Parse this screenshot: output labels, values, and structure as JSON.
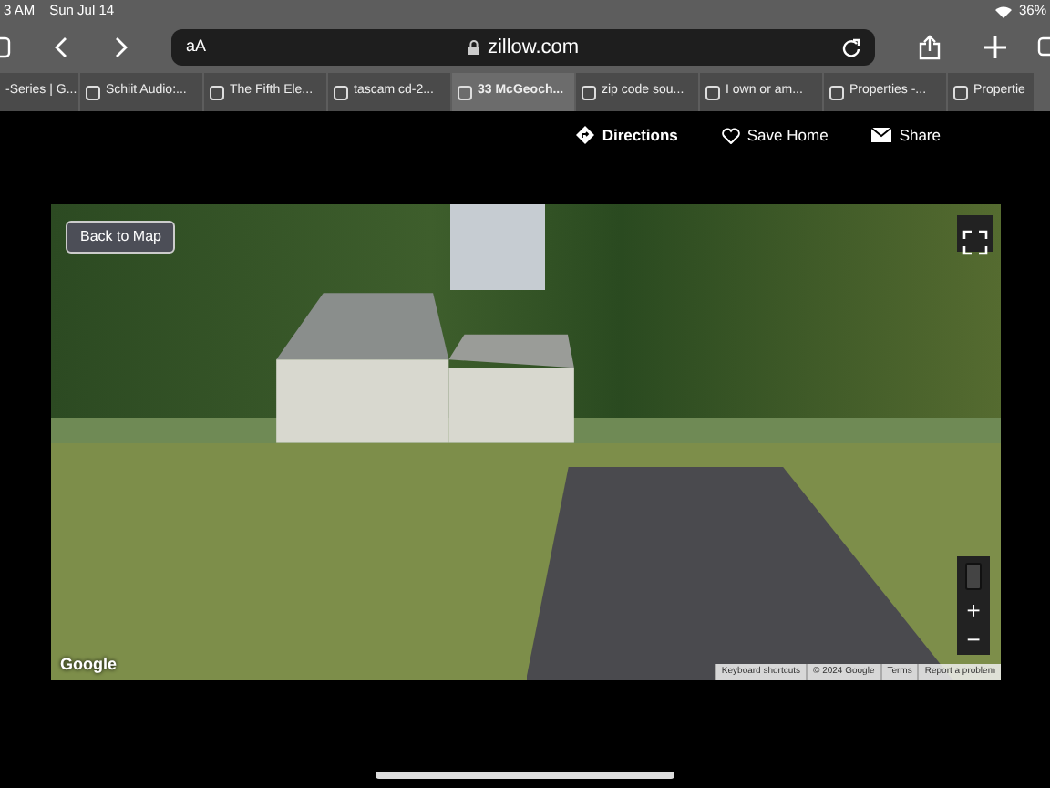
{
  "status_bar": {
    "time": "3 AM",
    "date": "Sun Jul 14",
    "battery": "36%"
  },
  "address_bar": {
    "text_size": "aA",
    "url": "zillow.com"
  },
  "tabs": [
    {
      "label": "-Series | G...",
      "selected": false
    },
    {
      "label": "Schiit Audio:...",
      "selected": false
    },
    {
      "label": "The Fifth Ele...",
      "selected": false
    },
    {
      "label": "tascam cd-2...",
      "selected": false
    },
    {
      "label": "33 McGeoch...",
      "selected": true
    },
    {
      "label": "zip code sou...",
      "selected": false
    },
    {
      "label": "I own or am...",
      "selected": false
    },
    {
      "label": "Properties -...",
      "selected": false
    },
    {
      "label": "Propertie",
      "selected": false
    }
  ],
  "actions": [
    {
      "kind": "directions",
      "label": "Directions"
    },
    {
      "kind": "save",
      "label": "Save Home"
    },
    {
      "kind": "share",
      "label": "Share"
    }
  ],
  "street_view": {
    "back_button": "Back to Map",
    "zoom_in": "+",
    "zoom_out": "−",
    "logo": "Google",
    "footer": [
      "Keyboard shortcuts",
      "© 2024 Google",
      "Terms",
      "Report a problem"
    ]
  }
}
